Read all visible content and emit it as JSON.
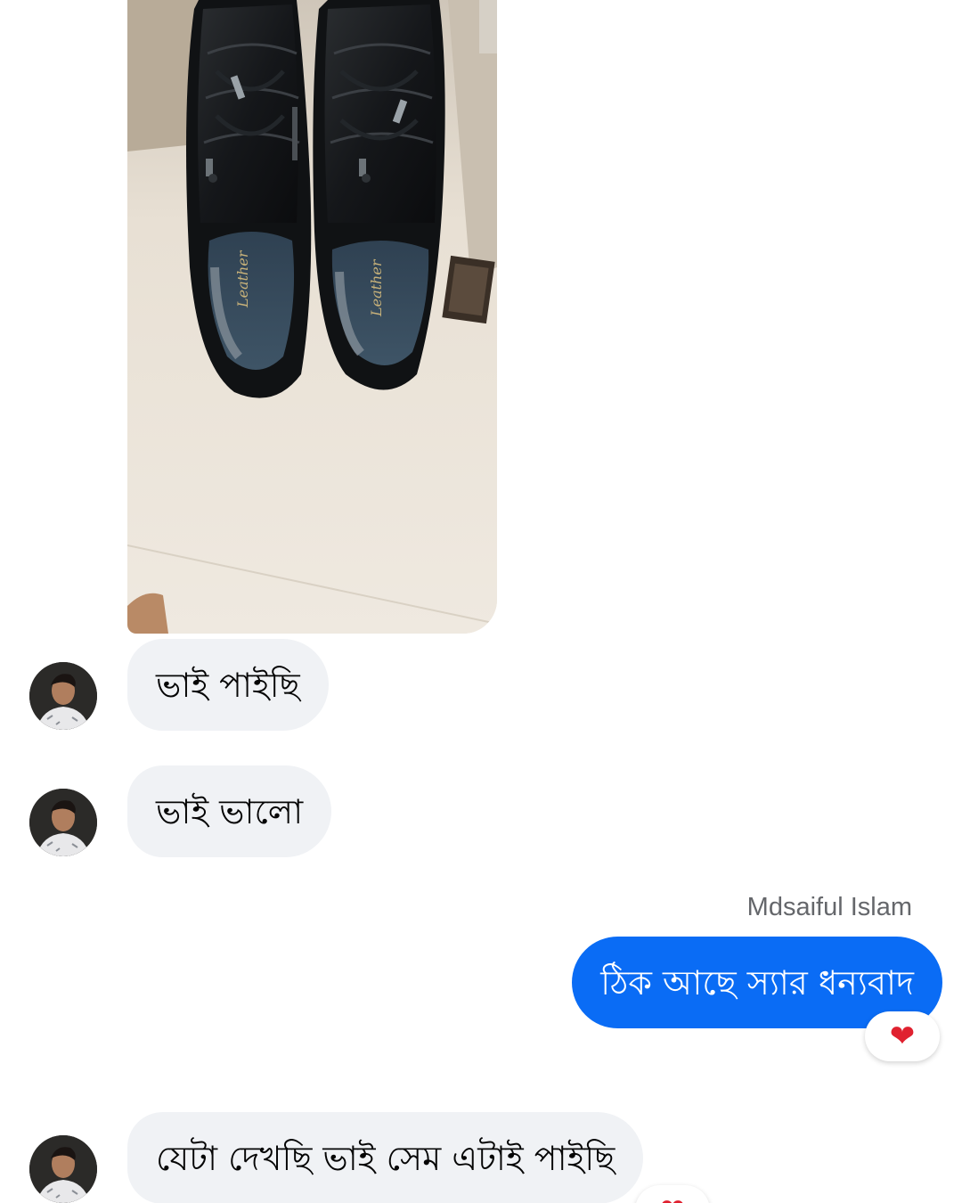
{
  "conversation": {
    "photo": {
      "alt": "",
      "insole_brand": "Leather"
    },
    "messages": [
      {
        "text": "ভাই পাইছি"
      },
      {
        "text": "ভাই ভালো"
      },
      {
        "sender": "Mdsaiful Islam",
        "text": "ঠিক আছে স্যার ধন্যবাদ",
        "reaction": "❤"
      },
      {
        "text": "যেটা দেখছি ভাই সেম এটাই পাইছি",
        "reaction": "❤"
      }
    ]
  },
  "colors": {
    "outgoing_bubble": "#0a6cf5",
    "incoming_bubble": "#f0f2f5",
    "reaction_heart": "#e0212f",
    "sender_name": "#65676b"
  },
  "icons": {
    "reaction": "heart-icon"
  }
}
